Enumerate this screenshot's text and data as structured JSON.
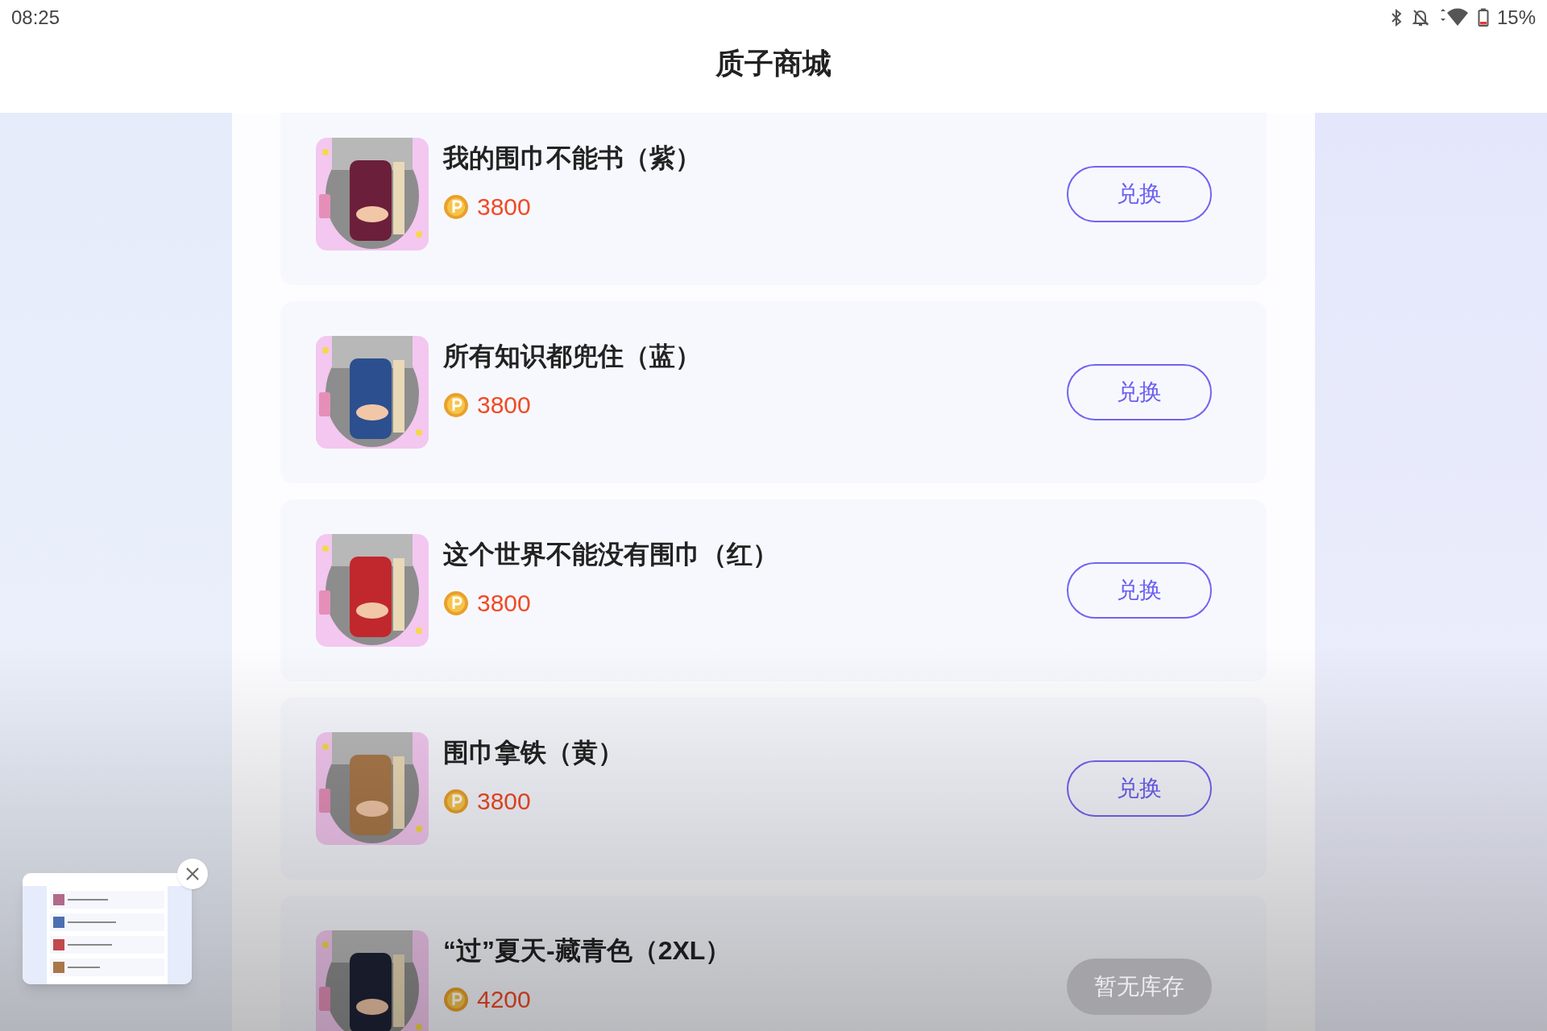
{
  "status_bar": {
    "time": "08:25",
    "battery": "15%"
  },
  "header": {
    "title": "质子商城"
  },
  "products": [
    {
      "name": "我的围巾不能书（紫）",
      "price": "3800",
      "button": {
        "label": "兑换",
        "disabled": false
      }
    },
    {
      "name": "所有知识都兜住（蓝）",
      "price": "3800",
      "button": {
        "label": "兑换",
        "disabled": false
      }
    },
    {
      "name": "这个世界不能没有围巾（红）",
      "price": "3800",
      "button": {
        "label": "兑换",
        "disabled": false
      }
    },
    {
      "name": "围巾拿铁（黄）",
      "price": "3800",
      "button": {
        "label": "兑换",
        "disabled": false
      }
    },
    {
      "name": "“过”夏天-藏青色（2XL）",
      "price": "4200",
      "button": {
        "label": "暂无库存",
        "disabled": true
      }
    }
  ]
}
